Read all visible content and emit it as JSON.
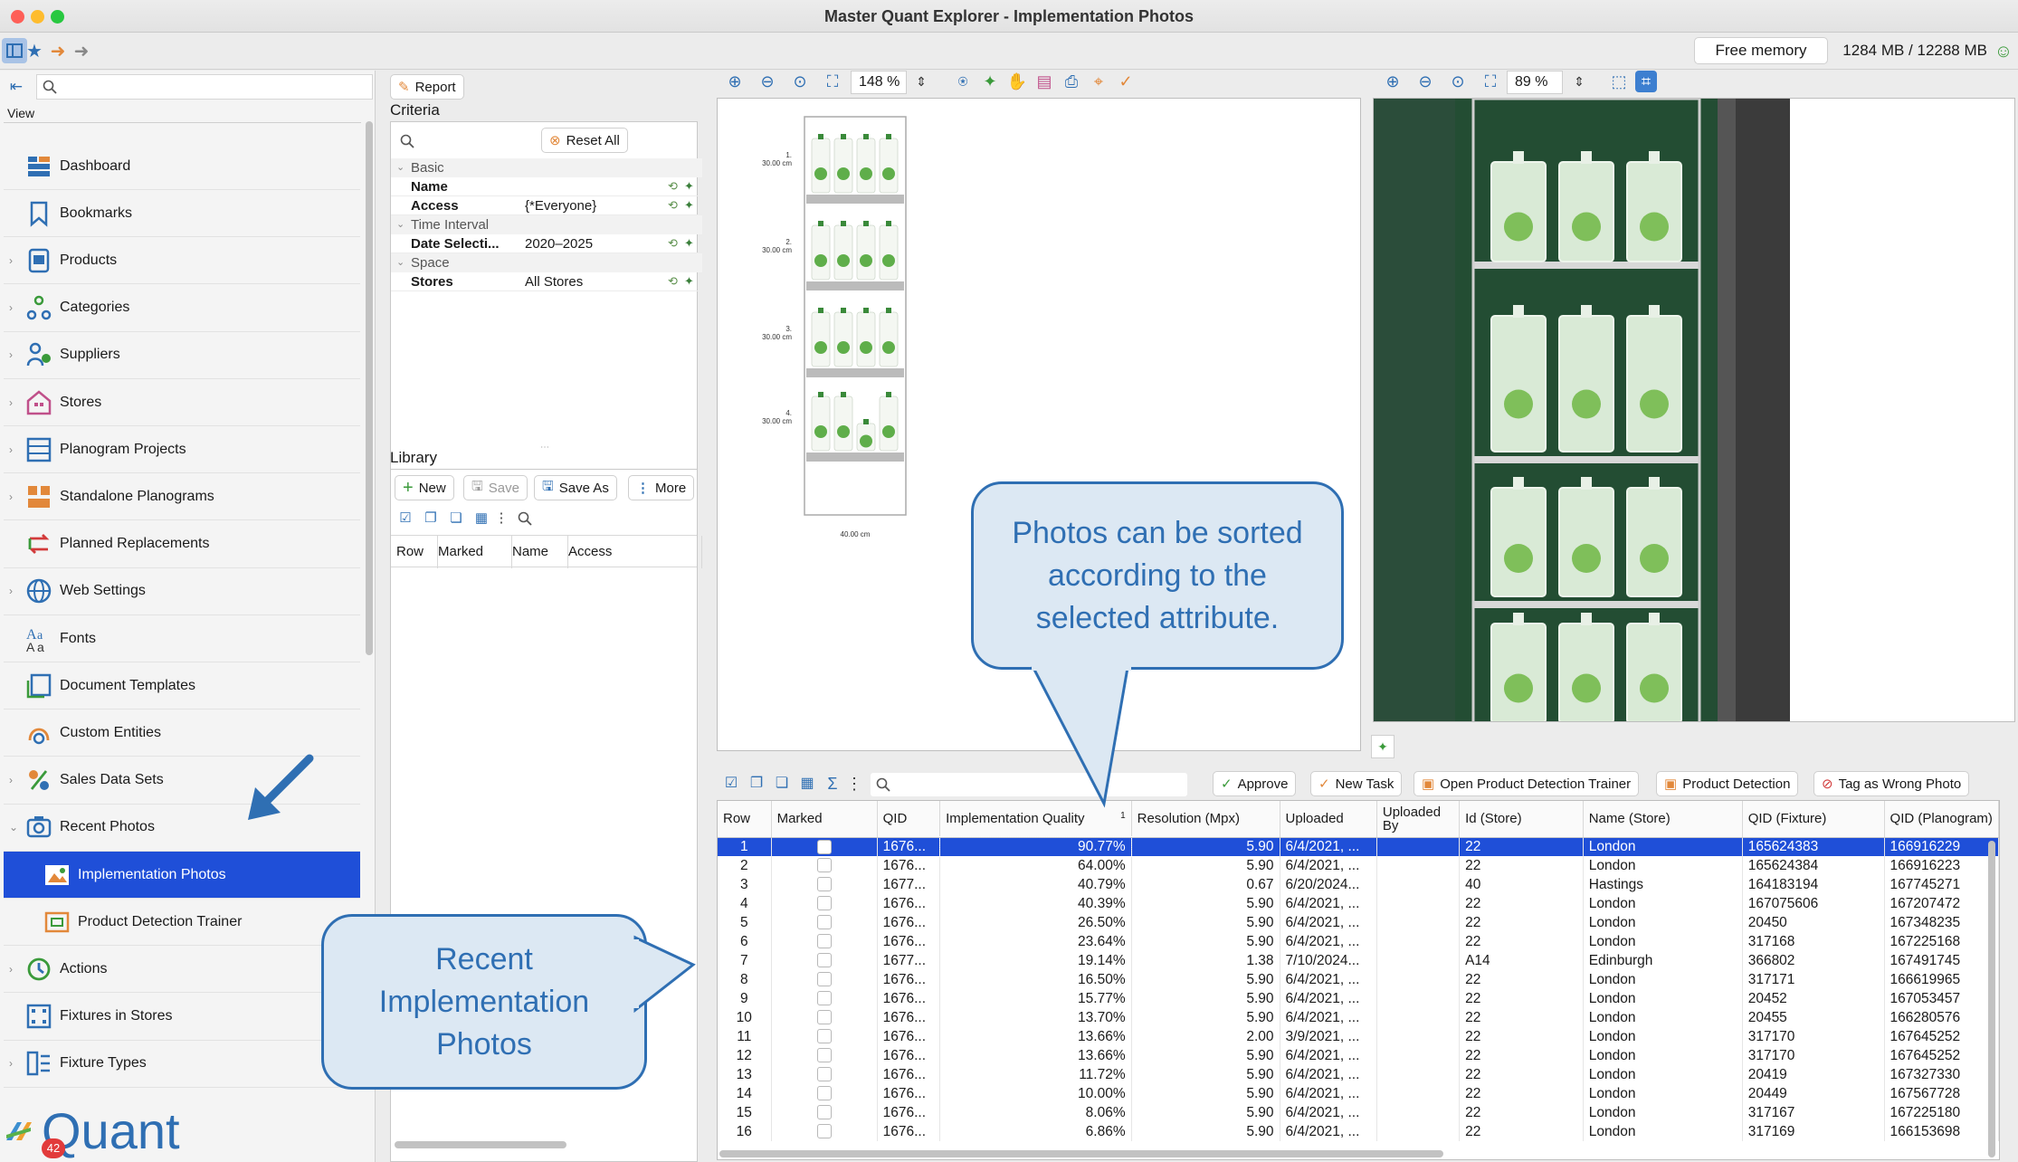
{
  "window": {
    "title": "Master Quant Explorer - Implementation Photos",
    "free_memory_label": "Free memory",
    "memory_value": "1284 MB / 12288 MB"
  },
  "sidebar": {
    "view_label": "View",
    "items": [
      {
        "label": "Dashboard",
        "icon": "dashboard-icon"
      },
      {
        "label": "Bookmarks",
        "icon": "bookmark-icon"
      },
      {
        "label": "Products",
        "icon": "products-icon"
      },
      {
        "label": "Categories",
        "icon": "categories-icon"
      },
      {
        "label": "Suppliers",
        "icon": "suppliers-icon"
      },
      {
        "label": "Stores",
        "icon": "store-icon"
      },
      {
        "label": "Planogram Projects",
        "icon": "planogram-projects-icon"
      },
      {
        "label": "Standalone Planograms",
        "icon": "standalone-planograms-icon"
      },
      {
        "label": "Planned Replacements",
        "icon": "replacements-icon"
      },
      {
        "label": "Web Settings",
        "icon": "globe-icon"
      },
      {
        "label": "Fonts",
        "icon": "fonts-icon"
      },
      {
        "label": "Document Templates",
        "icon": "document-templates-icon"
      },
      {
        "label": "Custom Entities",
        "icon": "custom-entities-icon"
      },
      {
        "label": "Sales Data Sets",
        "icon": "sales-data-icon"
      },
      {
        "label": "Recent Photos",
        "icon": "camera-icon"
      },
      {
        "label": "Implementation Photos",
        "icon": "photo-icon"
      },
      {
        "label": "Product Detection Trainer",
        "icon": "detection-trainer-icon"
      },
      {
        "label": "Actions",
        "icon": "actions-icon"
      },
      {
        "label": "Fixtures in Stores",
        "icon": "fixtures-icon"
      },
      {
        "label": "Fixture Types",
        "icon": "fixture-types-icon"
      }
    ],
    "messages_badge": "42",
    "logo_text": "Quant"
  },
  "criteria": {
    "report_label": "Report",
    "title": "Criteria",
    "reset_label": "Reset All",
    "groups": [
      {
        "name": "Basic",
        "rows": [
          {
            "k": "Name",
            "v": ""
          },
          {
            "k": "Access",
            "v": "{*Everyone}"
          }
        ]
      },
      {
        "name": "Time Interval",
        "rows": [
          {
            "k": "Date Selecti...",
            "v": "2020–2025"
          }
        ]
      },
      {
        "name": "Space",
        "rows": [
          {
            "k": "Stores",
            "v": "All Stores"
          }
        ]
      }
    ]
  },
  "library": {
    "title": "Library",
    "new_label": "New",
    "save_label": "Save",
    "save_as_label": "Save As",
    "more_label": "More",
    "columns": [
      "Row",
      "Marked",
      "Name",
      "Access"
    ]
  },
  "planogram": {
    "zoom": "148 %",
    "shelves": [
      {
        "num": "1.",
        "height": "30.00 cm"
      },
      {
        "num": "2.",
        "height": "30.00 cm"
      },
      {
        "num": "3.",
        "height": "30.00 cm"
      },
      {
        "num": "4.",
        "height": "30.00 cm"
      }
    ],
    "width_label": "40.00 cm"
  },
  "photo": {
    "zoom": "89 %"
  },
  "table": {
    "actions": {
      "approve": "Approve",
      "new_task": "New Task",
      "open_trainer": "Open Product Detection Trainer",
      "product_detection": "Product Detection",
      "tag_wrong": "Tag as Wrong Photo"
    },
    "columns": [
      "Row",
      "Marked",
      "QID",
      "Implementation Quality",
      "Resolution (Mpx)",
      "Uploaded",
      "Uploaded By",
      "Id (Store)",
      "Name (Store)",
      "QID (Fixture)",
      "QID (Planogram)"
    ],
    "sort_indicator": "1",
    "rows": [
      [
        "1",
        "",
        "1676...",
        "90.77%",
        "5.90",
        "6/4/2021, ...",
        "",
        "22",
        "London",
        "165624383",
        "166916229"
      ],
      [
        "2",
        "",
        "1676...",
        "64.00%",
        "5.90",
        "6/4/2021, ...",
        "",
        "22",
        "London",
        "165624384",
        "166916223"
      ],
      [
        "3",
        "",
        "1677...",
        "40.79%",
        "0.67",
        "6/20/2024...",
        "",
        "40",
        "Hastings",
        "164183194",
        "167745271"
      ],
      [
        "4",
        "",
        "1676...",
        "40.39%",
        "5.90",
        "6/4/2021, ...",
        "",
        "22",
        "London",
        "167075606",
        "167207472"
      ],
      [
        "5",
        "",
        "1676...",
        "26.50%",
        "5.90",
        "6/4/2021, ...",
        "",
        "22",
        "London",
        "20450",
        "167348235"
      ],
      [
        "6",
        "",
        "1676...",
        "23.64%",
        "5.90",
        "6/4/2021, ...",
        "",
        "22",
        "London",
        "317168",
        "167225168"
      ],
      [
        "7",
        "",
        "1677...",
        "19.14%",
        "1.38",
        "7/10/2024...",
        "",
        "A14",
        "Edinburgh",
        "366802",
        "167491745"
      ],
      [
        "8",
        "",
        "1676...",
        "16.50%",
        "5.90",
        "6/4/2021, ...",
        "",
        "22",
        "London",
        "317171",
        "166619965"
      ],
      [
        "9",
        "",
        "1676...",
        "15.77%",
        "5.90",
        "6/4/2021, ...",
        "",
        "22",
        "London",
        "20452",
        "167053457"
      ],
      [
        "10",
        "",
        "1676...",
        "13.70%",
        "5.90",
        "6/4/2021, ...",
        "",
        "22",
        "London",
        "20455",
        "166280576"
      ],
      [
        "11",
        "",
        "1676...",
        "13.66%",
        "2.00",
        "3/9/2021, ...",
        "",
        "22",
        "London",
        "317170",
        "167645252"
      ],
      [
        "12",
        "",
        "1676...",
        "13.66%",
        "5.90",
        "6/4/2021, ...",
        "",
        "22",
        "London",
        "317170",
        "167645252"
      ],
      [
        "13",
        "",
        "1676...",
        "11.72%",
        "5.90",
        "6/4/2021, ...",
        "",
        "22",
        "London",
        "20419",
        "167327330"
      ],
      [
        "14",
        "",
        "1676...",
        "10.00%",
        "5.90",
        "6/4/2021, ...",
        "",
        "22",
        "London",
        "20449",
        "167567728"
      ],
      [
        "15",
        "",
        "1676...",
        "8.06%",
        "5.90",
        "6/4/2021, ...",
        "",
        "22",
        "London",
        "317167",
        "167225180"
      ],
      [
        "16",
        "",
        "1676...",
        "6.86%",
        "5.90",
        "6/4/2021, ...",
        "",
        "22",
        "London",
        "317169",
        "166153698"
      ]
    ]
  },
  "callouts": {
    "sort": "Photos can be sorted according to the selected attribute.",
    "recent": "Recent Implementation Photos"
  },
  "colors": {
    "selection": "#1f4fd8",
    "callout_border": "#2f6fb3",
    "callout_fill": "#dce8f3",
    "product_green": "#5fae4a"
  }
}
